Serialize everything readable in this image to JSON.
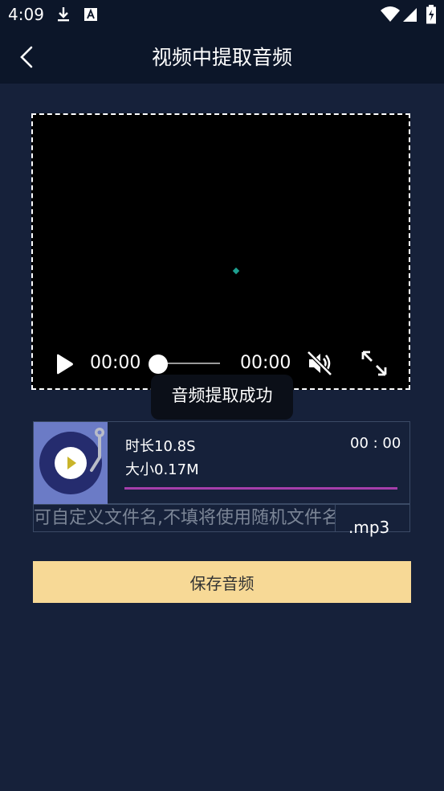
{
  "status_bar": {
    "time": "4:09",
    "icons": [
      "download-icon",
      "a-notification-icon",
      "wifi-icon",
      "signal-icon",
      "battery-icon"
    ]
  },
  "app_bar": {
    "title": "视频中提取音频",
    "back_icon": "chevron-left-icon"
  },
  "player": {
    "current_time": "00:00",
    "total_time": "00:00",
    "progress": 0,
    "icons": [
      "play-icon",
      "mute-icon",
      "fullscreen-icon"
    ]
  },
  "toast": {
    "message": "音频提取成功"
  },
  "audio_card": {
    "duration_label": "时长10.8S",
    "size_label": "大小0.17M",
    "play_time": "00 : 00",
    "progress": 0
  },
  "filename": {
    "placeholder": "可自定义文件名,不填将使用随机文件名",
    "value": "",
    "extension": ".mp3"
  },
  "save_button": {
    "label": "保存音频"
  },
  "colors": {
    "background": "#16213a",
    "bar": "#0c1629",
    "accent_button": "#f7d996",
    "progress": "#a53eaa",
    "thumb": "#6b7bc6"
  }
}
